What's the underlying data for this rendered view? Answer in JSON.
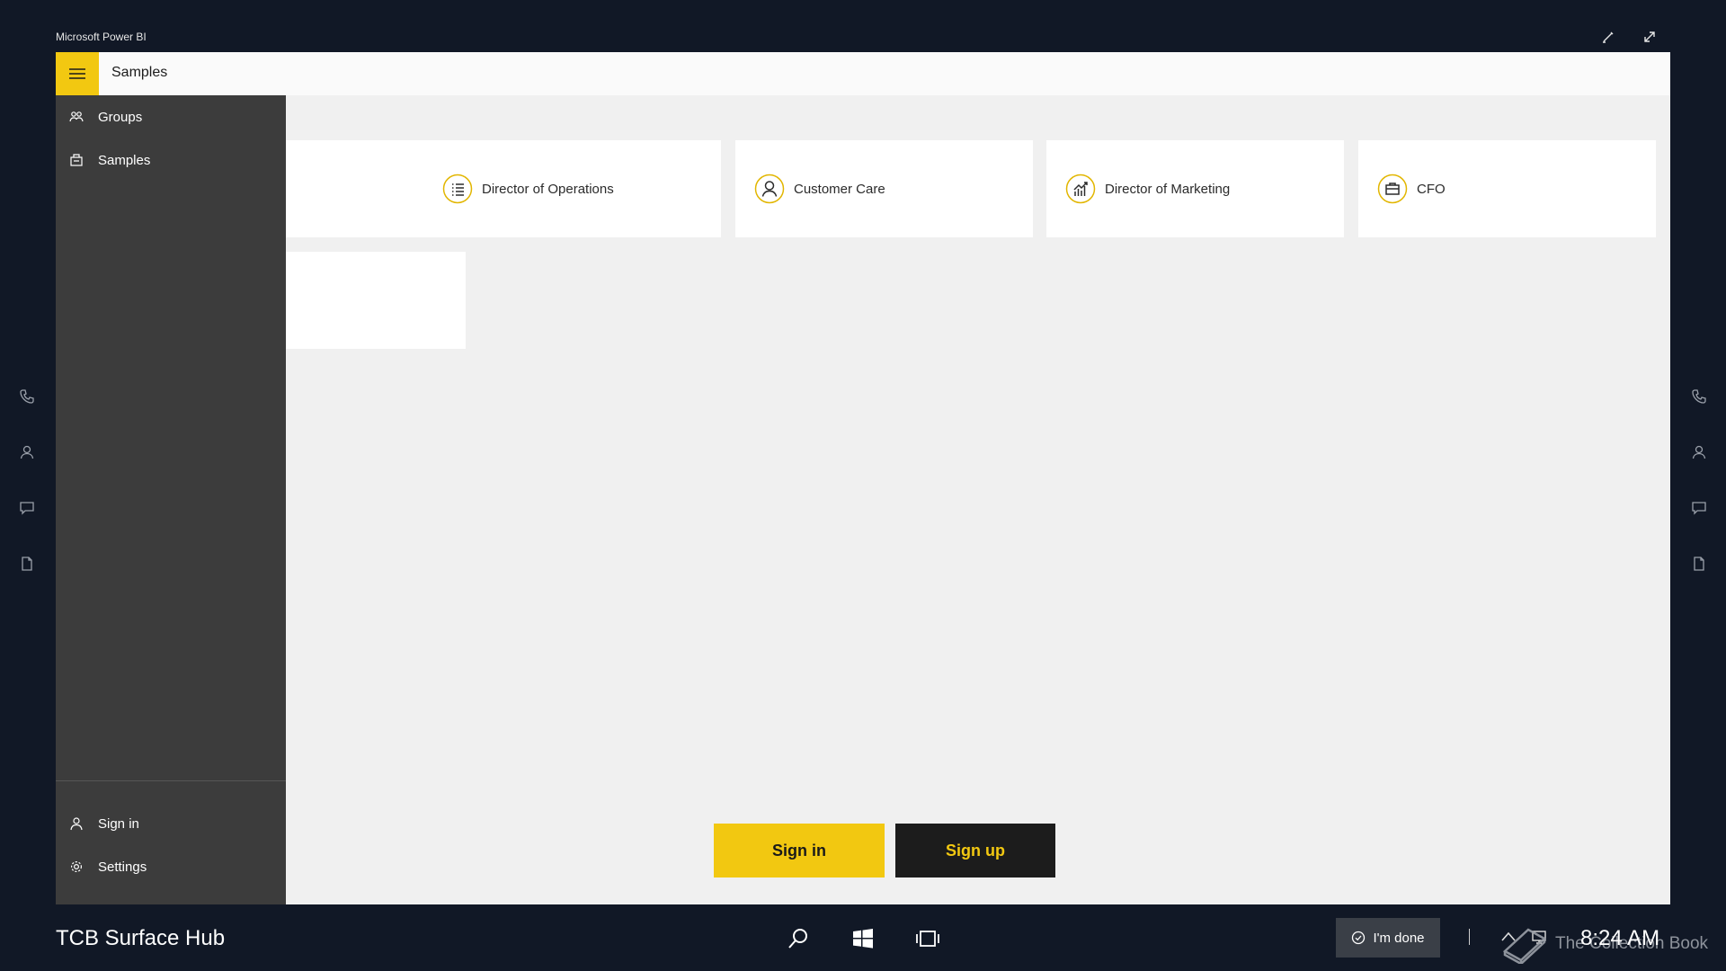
{
  "window": {
    "title": "Microsoft Power BI"
  },
  "window_controls": {
    "pen_icon": "pen-icon",
    "expand_icon": "expand-icon"
  },
  "app": {
    "title": "Samples",
    "accent_color": "#f2c811"
  },
  "nav": {
    "items": [
      {
        "label": "Groups",
        "icon": "groups-icon"
      },
      {
        "label": "Samples",
        "icon": "samples-icon"
      }
    ],
    "bottom_items": [
      {
        "label": "Sign in",
        "icon": "person-icon"
      },
      {
        "label": "Settings",
        "icon": "gear-icon"
      }
    ]
  },
  "cards": [
    {
      "label": "Director of Operations",
      "icon": "list-icon"
    },
    {
      "label": "Customer Care",
      "icon": "person-icon"
    },
    {
      "label": "Director of Marketing",
      "icon": "chart-icon"
    },
    {
      "label": "CFO",
      "icon": "briefcase-icon"
    }
  ],
  "actions": {
    "sign_in": "Sign in",
    "sign_up": "Sign up"
  },
  "rail_icons": [
    "phone-icon",
    "person-icon",
    "chat-icon",
    "document-icon"
  ],
  "taskbar": {
    "hub_name": "TCB Surface Hub",
    "done_label": "I'm done",
    "time": "8:24 AM",
    "watermark": "The Collection Book"
  }
}
